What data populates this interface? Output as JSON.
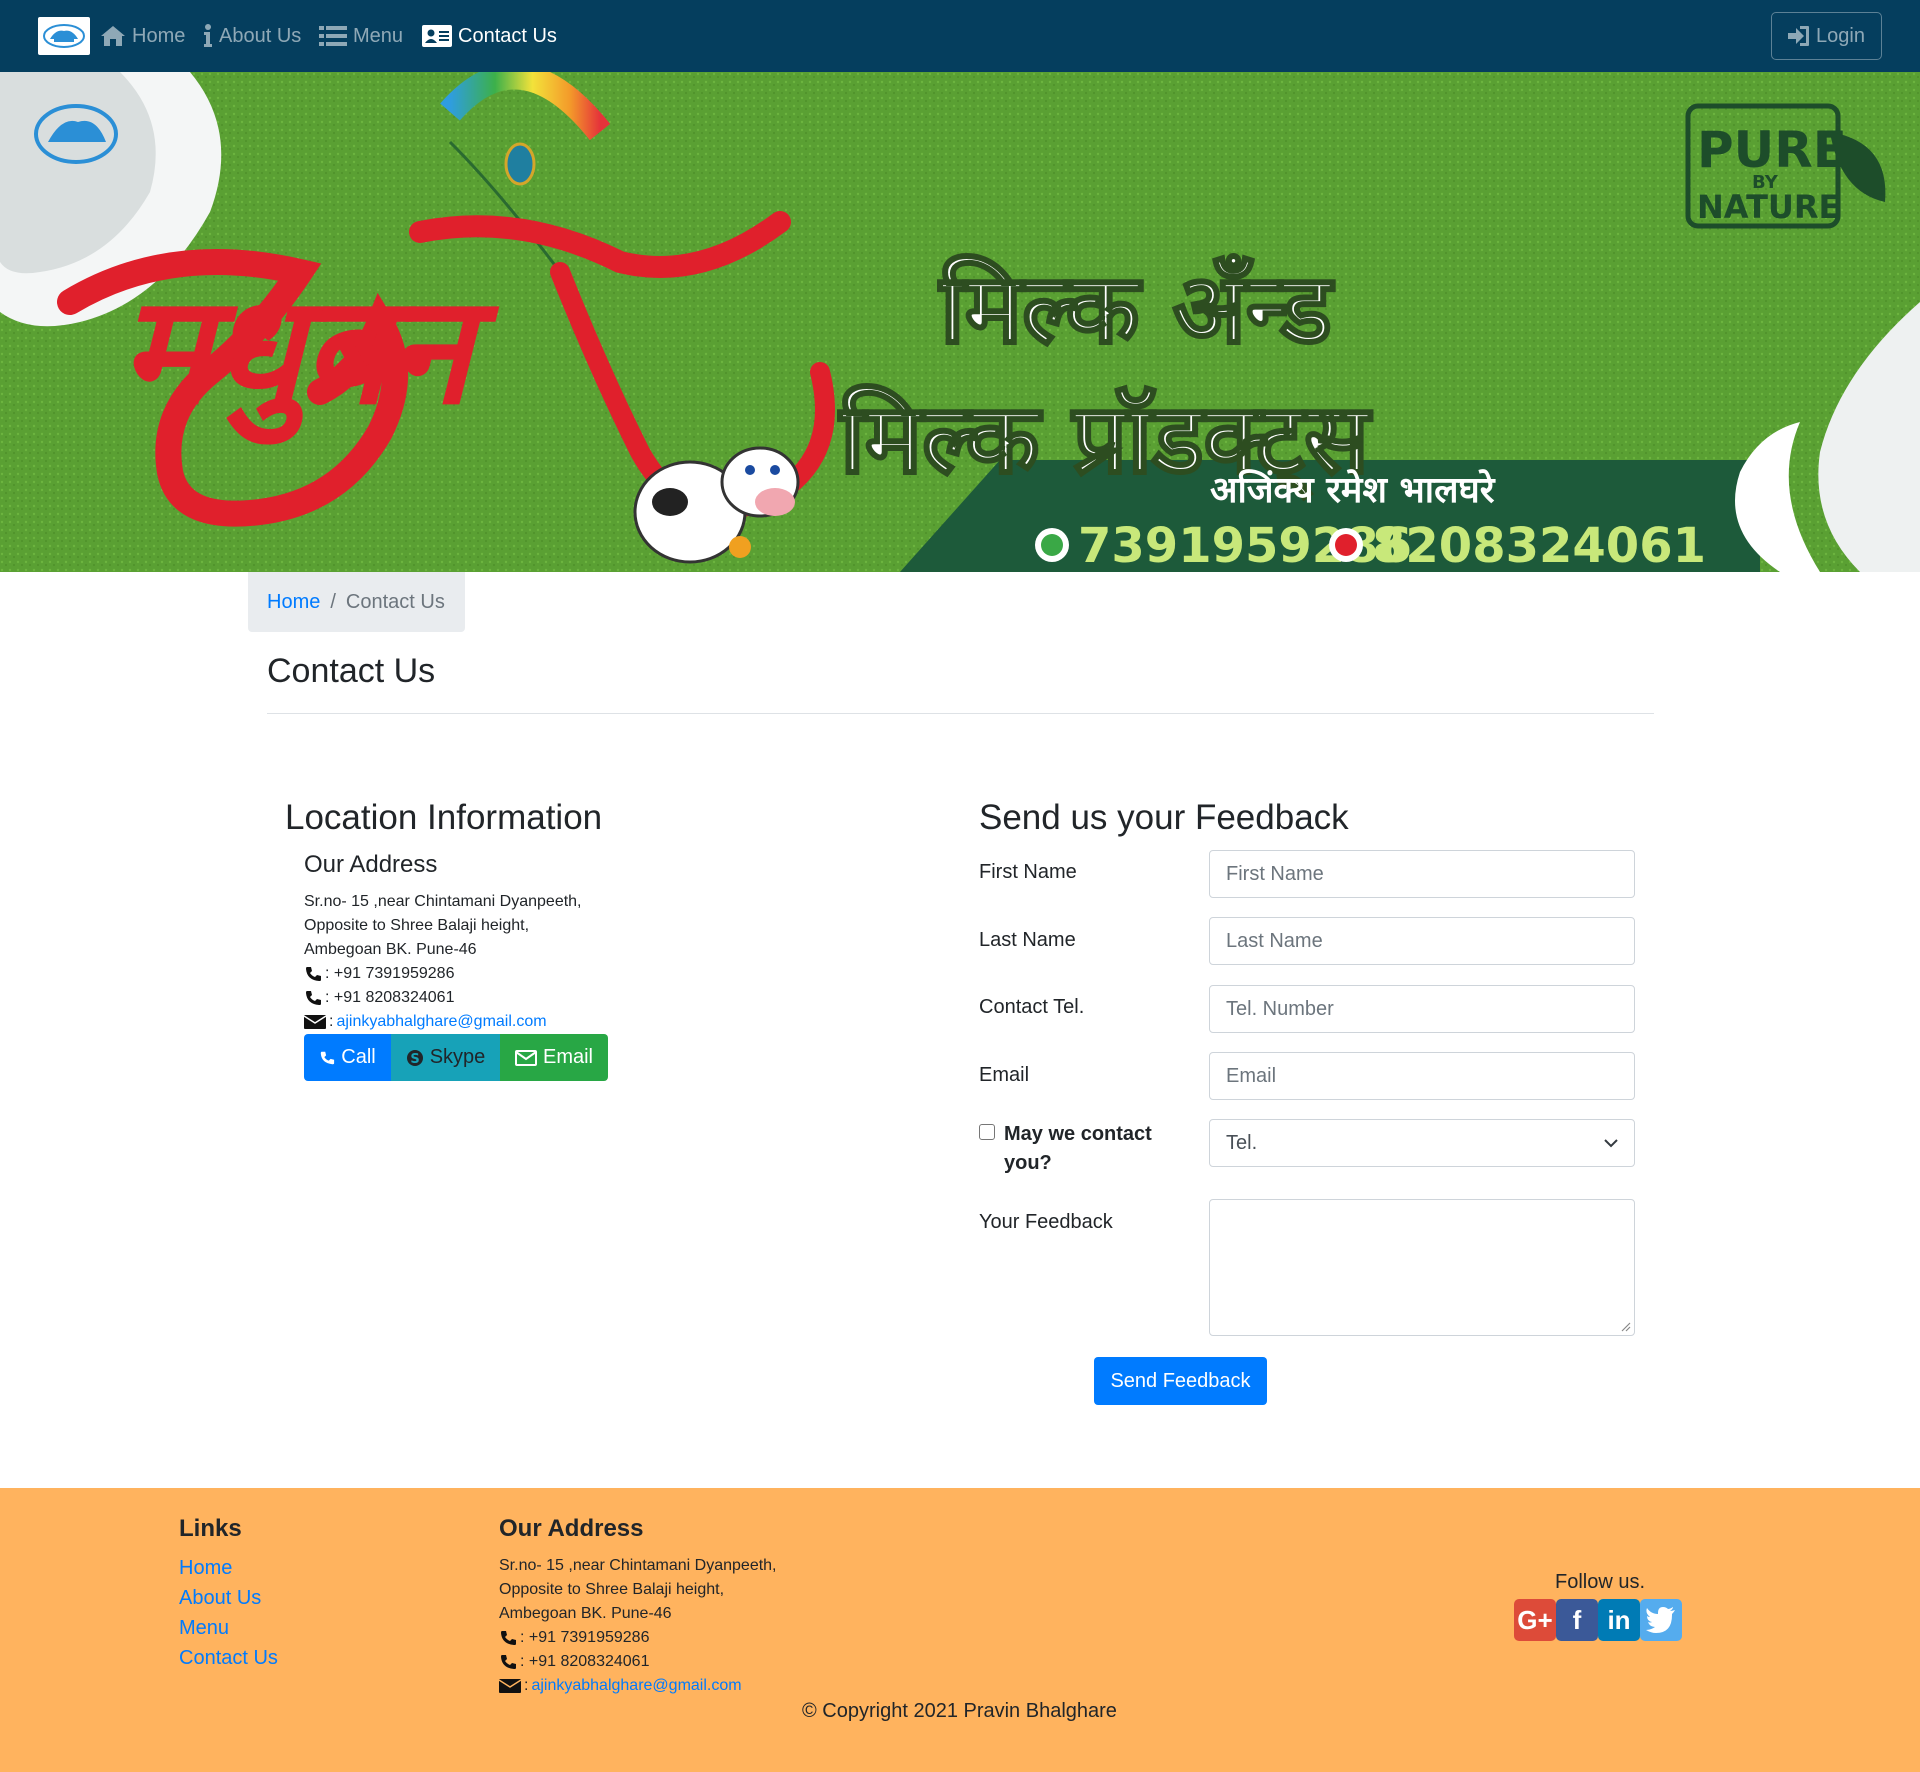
{
  "nav": {
    "links": [
      {
        "label": "Home"
      },
      {
        "label": "About Us"
      },
      {
        "label": "Menu"
      },
      {
        "label": "Contact Us"
      }
    ],
    "login_label": "Login"
  },
  "banner": {
    "brand_script": "मधुबन",
    "title_line1": "मिल्क अँन्ड",
    "title_line2": "मिल्क प्रॉडक्ट्स",
    "owner": "अजिंक्य रमेश भालघरे",
    "phone1": "7391959286",
    "phone2": "8208324061",
    "badge_top": "PURE",
    "badge_by": "BY",
    "badge_bottom": "NATURE"
  },
  "breadcrumb": {
    "home": "Home",
    "separator": "/",
    "current": "Contact Us"
  },
  "page_title": "Contact Us",
  "location": {
    "heading": "Location Information",
    "subheading": "Our Address",
    "line1": "Sr.no- 15 ,near Chintamani Dyanpeeth,",
    "line2": "Opposite to Shree Balaji height,",
    "line3": "Ambegoan BK. Pune-46",
    "phone1": ": +91 7391959286",
    "phone2": ": +91 8208324061",
    "email_prefix": ":",
    "email": "ajinkyabhalghare@gmail.com",
    "buttons": {
      "call": "Call",
      "skype": "Skype",
      "email": "Email"
    }
  },
  "feedback": {
    "heading": "Send us your Feedback",
    "first_name_label": "First Name",
    "first_name_placeholder": "First Name",
    "last_name_label": "Last Name",
    "last_name_placeholder": "Last Name",
    "tel_label": "Contact Tel.",
    "tel_placeholder": "Tel. Number",
    "email_label": "Email",
    "email_placeholder": "Email",
    "contact_label": "May we contact you?",
    "contact_select_value": "Tel.",
    "feedback_label": "Your Feedback",
    "send_label": "Send Feedback"
  },
  "footer": {
    "links_heading": "Links",
    "links": [
      "Home",
      "About Us",
      "Menu",
      "Contact Us"
    ],
    "address_heading": "Our Address",
    "line1": "Sr.no- 15 ,near Chintamani Dyanpeeth,",
    "line2": "Opposite to Shree Balaji height,",
    "line3": "Ambegoan BK. Pune-46",
    "phone1": ": +91 7391959286",
    "phone2": ": +91 8208324061",
    "email_prefix": ":",
    "email": "ajinkyabhalghare@gmail.com",
    "follow_label": "Follow us.",
    "social": [
      {
        "icon": "google-plus-icon",
        "glyph": "G+",
        "color": "#dd4b39"
      },
      {
        "icon": "facebook-icon",
        "glyph": "f",
        "color": "#3b5998"
      },
      {
        "icon": "linkedin-icon",
        "glyph": "in",
        "color": "#007bb5"
      },
      {
        "icon": "twitter-icon",
        "glyph": "",
        "color": "#55acee"
      }
    ],
    "copyright": "© Copyright 2021 Pravin Bhalghare"
  },
  "colors": {
    "navbar": "#053e5e",
    "footer": "#ffb35e",
    "primary": "#007bff",
    "info": "#17a2b8",
    "success": "#28a745",
    "banner_green": "#5aa033",
    "banner_dark_green": "#1d5a3a",
    "brand_red": "#e0202c"
  }
}
